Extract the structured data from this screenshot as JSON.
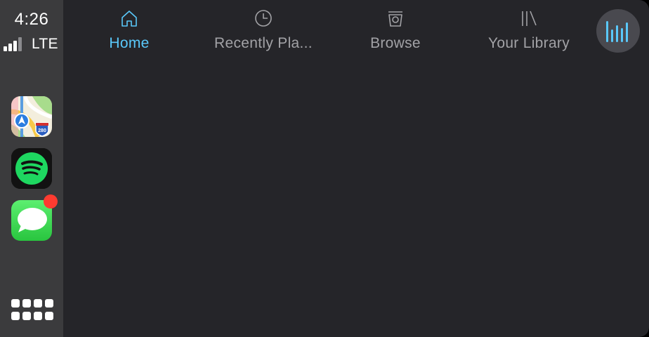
{
  "status": {
    "time": "4:26",
    "network": "LTE",
    "signal_bars_active": 3,
    "signal_bars_total": 4
  },
  "dock": {
    "apps": [
      {
        "name": "Maps",
        "icon": "maps-app-icon",
        "highway_shield": "280"
      },
      {
        "name": "Spotify",
        "icon": "spotify-app-icon"
      },
      {
        "name": "Messages",
        "icon": "messages-app-icon",
        "has_badge": true
      }
    ],
    "launcher_icon": "app-grid-icon"
  },
  "tabs": [
    {
      "label": "Home",
      "icon": "home-icon",
      "active": true
    },
    {
      "label": "Recently Pla...",
      "icon": "clock-icon",
      "active": false
    },
    {
      "label": "Browse",
      "icon": "browse-icon",
      "active": false
    },
    {
      "label": "Your Library",
      "icon": "library-icon",
      "active": false
    }
  ],
  "now_playing": {
    "icon": "now-playing-bars-icon"
  },
  "colors": {
    "accent": "#5ac8fa",
    "dock_background": "#3b3b3d",
    "main_background": "#252529",
    "inactive_tab": "#a2a2a6",
    "spotify_green": "#1ed760",
    "badge_red": "#ff3b30"
  }
}
